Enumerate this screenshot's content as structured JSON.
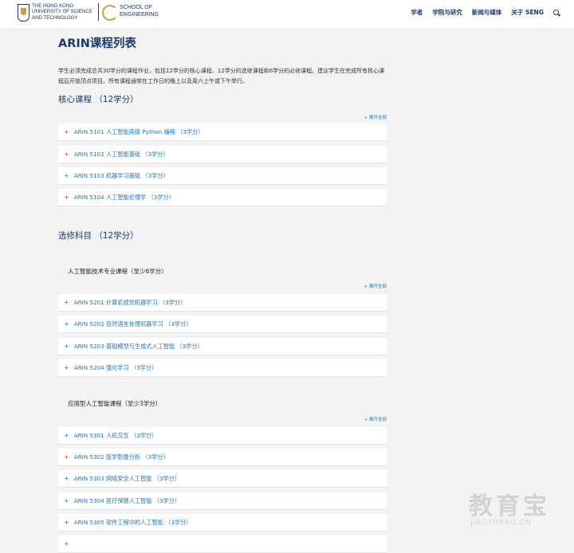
{
  "header": {
    "hkust_logo_lines": [
      "THE HONG KONG",
      "UNIVERSITY OF SCIENCE",
      "AND TECHNOLOGY"
    ],
    "eng_logo_lines": [
      "SCHOOL OF",
      "ENGINEERING"
    ],
    "nav": [
      "学者",
      "学院与研究",
      "新闻与媒体",
      "关于 SENG"
    ]
  },
  "page_title": "ARIN课程列表",
  "intro": "学生必须完成总共30学分的课程作业，包括12学分的核心课程、12学分的选修课程和6学分的必修课程。建议学生在完成所有核心课程后开始顶点项目。所有课程通常在工作日的晚上以及周六上午或下午举行。",
  "expand_all": "展开全部",
  "core": {
    "heading": "核心课程  （12学分）",
    "items": [
      "ARIN 5101 人工智能高级 Python 编程 （3学分）",
      "ARIN 5102 人工智能基础 （3学分）",
      "ARIN 5103 机器学习基础 （3学分）",
      "ARIN 5104 人工智能伦理学 （3学分）"
    ]
  },
  "elective": {
    "heading": "选修科目  （12学分）",
    "groups": [
      {
        "heading": "人工智能技术专业课程（至少6学分）",
        "items": [
          "ARIN 5201 计算机视觉机器学习 （3学分）",
          "ARIN 5202 自然语言处理机器学习 （3学分）",
          "ARIN 5203 基础模型与生成式人工智能 （3学分）",
          "ARIN 5204 强化学习 （3学分）"
        ]
      },
      {
        "heading": "应用型人工智能课程（至少3学分）",
        "items": [
          "ARIN 5301 人机交互 （3学分）",
          "ARIN 5302 医学影像分析 （3学分）",
          "ARIN 5303 网络安全人工智能 （3学分）",
          "ARIN 5304 医疗保健人工智能 （3学分）",
          "ARIN 5305 软件工程中的人工智能 （3学分）"
        ]
      }
    ]
  },
  "watermark": {
    "main": "教育宝",
    "url": "JIAOYUBAO.CN"
  }
}
